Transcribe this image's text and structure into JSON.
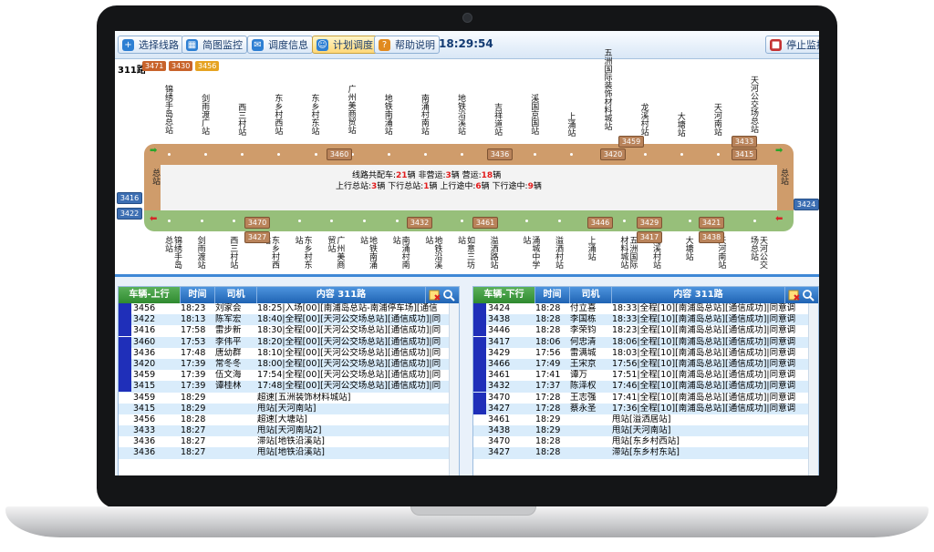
{
  "toolbar": {
    "buttons": [
      {
        "label": "选择线路",
        "icon": "plus-icon"
      },
      {
        "label": "简图监控",
        "icon": "map-icon"
      },
      {
        "label": "调度信息",
        "icon": "message-icon"
      },
      {
        "label": "计划调度",
        "icon": "person-icon"
      },
      {
        "label": "帮助说明",
        "icon": "help-icon"
      }
    ],
    "clock": "18:29:54",
    "stop_label": "停止监控"
  },
  "route": {
    "name": "311路",
    "legend_chips": [
      {
        "label": "3471",
        "color": "#c8632b"
      },
      {
        "label": "3430",
        "color": "#c8632b"
      },
      {
        "label": "3456",
        "color": "#e6a322"
      }
    ],
    "top_stations": [
      "锦绣手岛总站",
      "剑雨渡广站",
      "西三村站",
      "东乡村西站",
      "东乡村东站",
      "广州美商贸站",
      "地铁南涌站",
      "南涌村南站",
      "地铁沿溪站",
      "吉祥道站",
      "溪国京国站",
      "上涌站",
      "五洲国际装饰材料城站",
      "龙溪村站",
      "大塘站",
      "天河南站",
      "天河公交场总站"
    ],
    "bottom_stations": [
      "锦绣手岛总站",
      "剑雨渡站",
      "西三村站",
      "东乡村西站",
      "东乡村东站",
      "广州美商贸站",
      "地铁南涌站",
      "南涌村南站",
      "地铁沿溪站",
      "如意三坊站",
      "溢洒路站",
      "涌城中学站",
      "溢洒村站",
      "上涌站",
      "五洲国际材料城站",
      "龙溪村站",
      "大塘站",
      "天河南站",
      "天河公交场总站"
    ],
    "end_left": "总站",
    "end_right": "总站",
    "top_buses": [
      "3460",
      "3436",
      "3420",
      "3459",
      "3433",
      "3415"
    ],
    "bottom_buses": [
      "3470",
      "3427",
      "3432",
      "3461",
      "3446",
      "3429",
      "3417",
      "3421",
      "3438"
    ],
    "side_buses": [
      "3416",
      "3422",
      "3424"
    ],
    "info_line1": {
      "p1": "线路共配车:",
      "v1": "21",
      "p2": "辆  非营运:",
      "v2": "3",
      "p3": "辆  营运:",
      "v3": "18",
      "p4": "辆"
    },
    "info_line2": {
      "p1": "上行总站:",
      "v1": "3",
      "p2": "辆  下行总站:",
      "v2": "1",
      "p3": "辆  上行途中:",
      "v3": "6",
      "p4": "辆  下行途中:",
      "v4": "9",
      "p5": "辆"
    }
  },
  "table_up": {
    "headers": [
      "车辆-上行",
      "时间",
      "司机",
      "内容 311路"
    ],
    "rows": [
      {
        "bus": "3456",
        "time": "18:23",
        "driver": "刘家会",
        "content": "18:25|入场[00][南浦岛总站-南浦停车场][通信",
        "active": true
      },
      {
        "bus": "3422",
        "time": "18:13",
        "driver": "陈军宏",
        "content": "18:40|全程[00][天河公交场总站][通信成功]|同",
        "active": true
      },
      {
        "bus": "3416",
        "time": "17:58",
        "driver": "雷步新",
        "content": "18:30|全程[00][天河公交场总站][通信成功]|同",
        "active": true
      },
      {
        "bus": "3460",
        "time": "17:53",
        "driver": "李伟平",
        "content": "18:20|全程[00][天河公交场总站][通信成功]|同",
        "active": true
      },
      {
        "bus": "3436",
        "time": "17:48",
        "driver": "唐幼群",
        "content": "18:10|全程[00][天河公交场总站][通信成功]|同",
        "active": true
      },
      {
        "bus": "3420",
        "time": "17:39",
        "driver": "常冬冬",
        "content": "18:00|全程[00][天河公交场总站][通信成功]|同",
        "active": true
      },
      {
        "bus": "3459",
        "time": "17:39",
        "driver": "伍文海",
        "content": "17:54|全程[00][天河公交场总站][通信成功]|同",
        "active": true
      },
      {
        "bus": "3415",
        "time": "17:39",
        "driver": "谭桂林",
        "content": "17:48|全程[00][天河公交场总站][通信成功]|同",
        "active": true
      },
      {
        "bus": "3459",
        "time": "18:29",
        "driver": "",
        "content": "超速[五洲装饰材料城站]",
        "active": false
      },
      {
        "bus": "3415",
        "time": "18:29",
        "driver": "",
        "content": "甩站[天河南站]",
        "active": false
      },
      {
        "bus": "3456",
        "time": "18:28",
        "driver": "",
        "content": "超速[大塘站]",
        "active": false
      },
      {
        "bus": "3433",
        "time": "18:27",
        "driver": "",
        "content": "甩站[天河南站2]",
        "active": false
      },
      {
        "bus": "3436",
        "time": "18:27",
        "driver": "",
        "content": "滞站[地铁沿溪站]",
        "active": false
      },
      {
        "bus": "3436",
        "time": "18:27",
        "driver": "",
        "content": "甩站[地铁沿溪站]",
        "active": false
      }
    ]
  },
  "table_down": {
    "headers": [
      "车辆-下行",
      "时间",
      "司机",
      "内容 311路"
    ],
    "rows": [
      {
        "bus": "3424",
        "time": "18:28",
        "driver": "付立喜",
        "content": "18:33|全程[10][南浦岛总站][通信成功]|同意调",
        "active": true
      },
      {
        "bus": "3438",
        "time": "18:28",
        "driver": "李国栋",
        "content": "18:33|全程[10][南浦岛总站][通信成功]|同意调",
        "active": true
      },
      {
        "bus": "3446",
        "time": "18:28",
        "driver": "李荣钧",
        "content": "18:23|全程[10][南浦岛总站][通信成功]|同意调",
        "active": true
      },
      {
        "bus": "3417",
        "time": "18:06",
        "driver": "何忠清",
        "content": "18:06|全程[10][南浦岛总站][通信成功]|同意调",
        "active": true
      },
      {
        "bus": "3429",
        "time": "17:56",
        "driver": "雷满城",
        "content": "18:03|全程[10][南浦岛总站][通信成功]|同意调",
        "active": true
      },
      {
        "bus": "3466",
        "time": "17:49",
        "driver": "王宋京",
        "content": "17:56|全程[10][南浦岛总站][通信成功]|同意调",
        "active": true
      },
      {
        "bus": "3461",
        "time": "17:41",
        "driver": "谭万",
        "content": "17:51|全程[10][南浦岛总站][通信成功]|同意调",
        "active": true
      },
      {
        "bus": "3432",
        "time": "17:37",
        "driver": "陈泽权",
        "content": "17:46|全程[10][南浦岛总站][通信成功]|同意调",
        "active": true
      },
      {
        "bus": "3470",
        "time": "17:28",
        "driver": "王志强",
        "content": "17:41|全程[10][南浦岛总站][通信成功]|同意调",
        "active": true
      },
      {
        "bus": "3427",
        "time": "17:28",
        "driver": "蔡永圣",
        "content": "17:36|全程[10][南浦岛总站][通信成功]|同意调",
        "active": true
      },
      {
        "bus": "3461",
        "time": "18:29",
        "driver": "",
        "content": "甩站[溢洒居站]",
        "active": false
      },
      {
        "bus": "3438",
        "time": "18:29",
        "driver": "",
        "content": "甩站[天河南站]",
        "active": false
      },
      {
        "bus": "3470",
        "time": "18:28",
        "driver": "",
        "content": "甩站[东乡村西站]",
        "active": false
      },
      {
        "bus": "3427",
        "time": "18:28",
        "driver": "",
        "content": "滞站[东乡村东站]",
        "active": false
      }
    ]
  }
}
